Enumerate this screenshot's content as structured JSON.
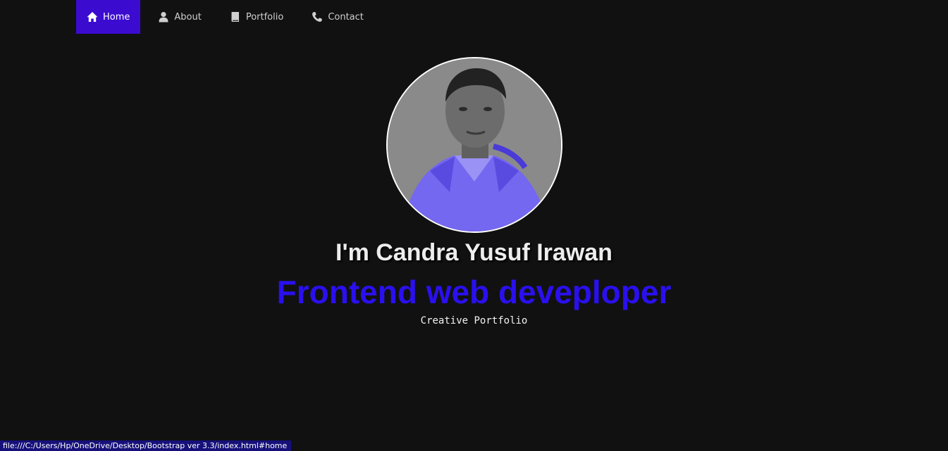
{
  "nav": {
    "items": [
      {
        "label": "Home",
        "icon": "home-icon",
        "active": true
      },
      {
        "label": "About",
        "icon": "user-icon",
        "active": false
      },
      {
        "label": "Portfolio",
        "icon": "book-icon",
        "active": false
      },
      {
        "label": "Contact",
        "icon": "phone-icon",
        "active": false
      }
    ]
  },
  "hero": {
    "name": "I'm Candra Yusuf Irawan",
    "role": "Frontend web deveploper",
    "tagline": "Creative Portfolio"
  },
  "status_bar": {
    "url": "file:///C:/Users/Hp/OneDrive/Desktop/Bootstrap ver 3.3/index.html#home"
  },
  "colors": {
    "background": "#111111",
    "accent": "#3b0bd0",
    "role_text": "#2a10ee",
    "status_bar": "#16107a"
  }
}
